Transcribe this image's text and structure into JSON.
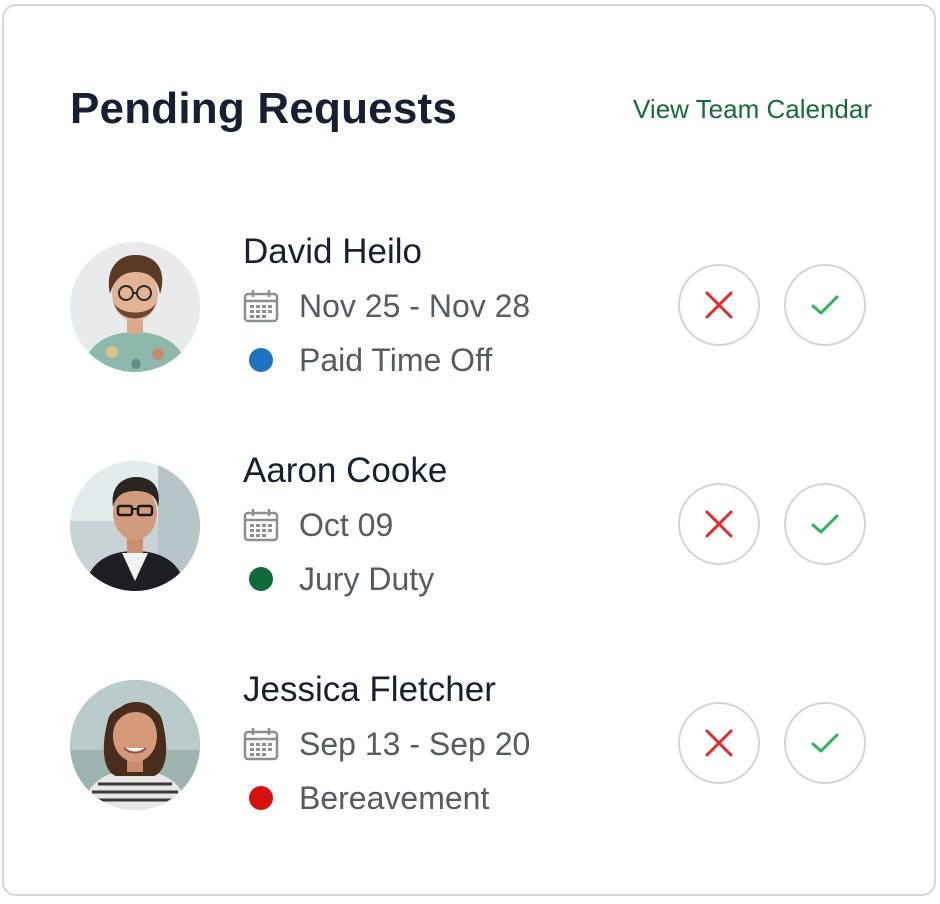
{
  "header": {
    "title": "Pending Requests",
    "view_link": "View Team Calendar"
  },
  "colors": {
    "link": "#166b3c",
    "reject": "#e5282c",
    "approve": "#2bb55b"
  },
  "requests": [
    {
      "name": "David Heilo",
      "dates": "Nov 25 - Nov 28",
      "type": "Paid Time Off",
      "type_color": "#1f73c2",
      "icons": {
        "date": "calendar-icon",
        "reject": "close-icon",
        "approve": "check-icon"
      }
    },
    {
      "name": "Aaron Cooke",
      "dates": "Oct 09",
      "type": "Jury Duty",
      "type_color": "#0e6b35",
      "icons": {
        "date": "calendar-icon",
        "reject": "close-icon",
        "approve": "check-icon"
      }
    },
    {
      "name": "Jessica Fletcher",
      "dates": "Sep 13 - Sep 20",
      "type": "Bereavement",
      "type_color": "#d60f0f",
      "icons": {
        "date": "calendar-icon",
        "reject": "close-icon",
        "approve": "check-icon"
      }
    }
  ]
}
